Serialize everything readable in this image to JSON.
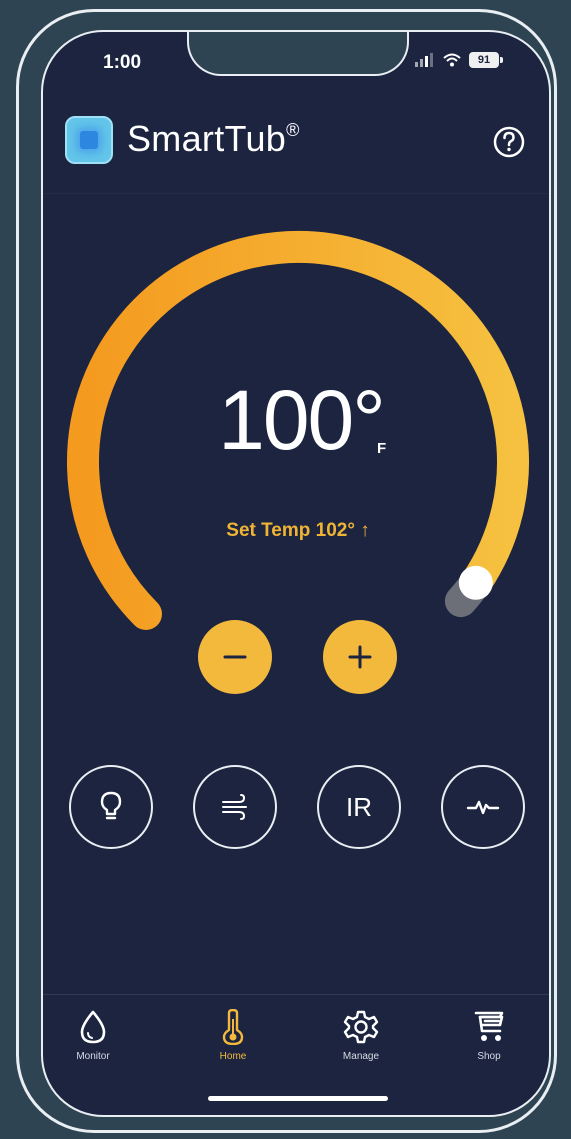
{
  "status_bar": {
    "time": "1:00",
    "battery": "91"
  },
  "header": {
    "app_name": "SmartTub",
    "trademark": "®"
  },
  "thermostat": {
    "current_temp": "100°",
    "unit": "F",
    "set_temp_label": "Set Temp 102° ↑",
    "gauge_level": 0.96
  },
  "controls": {
    "decrease_symbol": "−",
    "increase_symbol": "+",
    "buttons": [
      {
        "name": "light",
        "icon": "lightbulb-icon"
      },
      {
        "name": "jets",
        "icon": "air-flow-icon"
      },
      {
        "name": "ir",
        "label": "IR"
      },
      {
        "name": "monitor",
        "icon": "pulse-icon"
      }
    ]
  },
  "tabs": [
    {
      "label": "Monitor",
      "icon": "water-drop-icon",
      "active": false
    },
    {
      "label": "Home",
      "icon": "thermometer-icon",
      "active": true
    },
    {
      "label": "Manage",
      "icon": "gear-icon",
      "active": false
    },
    {
      "label": "Shop",
      "icon": "cart-icon",
      "active": false
    }
  ],
  "colors": {
    "background": "#1c2440",
    "accent": "#f3b93c",
    "gauge_start": "#f49a1f",
    "gauge_end": "#f6c140",
    "text": "#ffffff"
  }
}
